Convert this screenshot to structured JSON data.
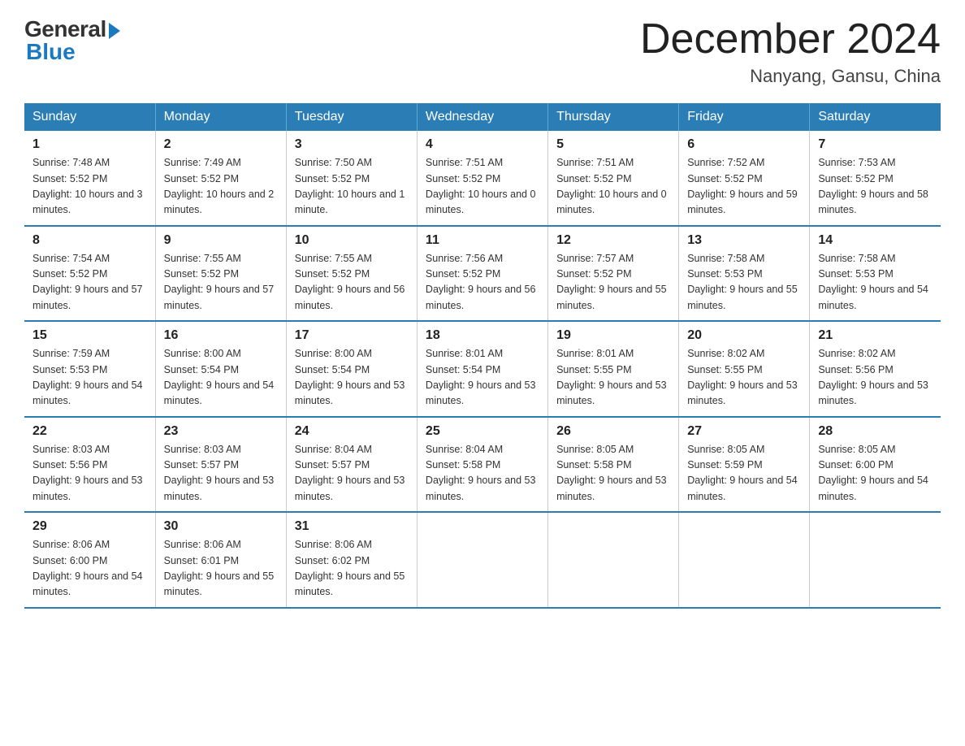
{
  "header": {
    "title": "December 2024",
    "location": "Nanyang, Gansu, China",
    "logo_general": "General",
    "logo_blue": "Blue"
  },
  "days_of_week": [
    "Sunday",
    "Monday",
    "Tuesday",
    "Wednesday",
    "Thursday",
    "Friday",
    "Saturday"
  ],
  "weeks": [
    [
      {
        "num": "1",
        "sunrise": "7:48 AM",
        "sunset": "5:52 PM",
        "daylight": "10 hours and 3 minutes."
      },
      {
        "num": "2",
        "sunrise": "7:49 AM",
        "sunset": "5:52 PM",
        "daylight": "10 hours and 2 minutes."
      },
      {
        "num": "3",
        "sunrise": "7:50 AM",
        "sunset": "5:52 PM",
        "daylight": "10 hours and 1 minute."
      },
      {
        "num": "4",
        "sunrise": "7:51 AM",
        "sunset": "5:52 PM",
        "daylight": "10 hours and 0 minutes."
      },
      {
        "num": "5",
        "sunrise": "7:51 AM",
        "sunset": "5:52 PM",
        "daylight": "10 hours and 0 minutes."
      },
      {
        "num": "6",
        "sunrise": "7:52 AM",
        "sunset": "5:52 PM",
        "daylight": "9 hours and 59 minutes."
      },
      {
        "num": "7",
        "sunrise": "7:53 AM",
        "sunset": "5:52 PM",
        "daylight": "9 hours and 58 minutes."
      }
    ],
    [
      {
        "num": "8",
        "sunrise": "7:54 AM",
        "sunset": "5:52 PM",
        "daylight": "9 hours and 57 minutes."
      },
      {
        "num": "9",
        "sunrise": "7:55 AM",
        "sunset": "5:52 PM",
        "daylight": "9 hours and 57 minutes."
      },
      {
        "num": "10",
        "sunrise": "7:55 AM",
        "sunset": "5:52 PM",
        "daylight": "9 hours and 56 minutes."
      },
      {
        "num": "11",
        "sunrise": "7:56 AM",
        "sunset": "5:52 PM",
        "daylight": "9 hours and 56 minutes."
      },
      {
        "num": "12",
        "sunrise": "7:57 AM",
        "sunset": "5:52 PM",
        "daylight": "9 hours and 55 minutes."
      },
      {
        "num": "13",
        "sunrise": "7:58 AM",
        "sunset": "5:53 PM",
        "daylight": "9 hours and 55 minutes."
      },
      {
        "num": "14",
        "sunrise": "7:58 AM",
        "sunset": "5:53 PM",
        "daylight": "9 hours and 54 minutes."
      }
    ],
    [
      {
        "num": "15",
        "sunrise": "7:59 AM",
        "sunset": "5:53 PM",
        "daylight": "9 hours and 54 minutes."
      },
      {
        "num": "16",
        "sunrise": "8:00 AM",
        "sunset": "5:54 PM",
        "daylight": "9 hours and 54 minutes."
      },
      {
        "num": "17",
        "sunrise": "8:00 AM",
        "sunset": "5:54 PM",
        "daylight": "9 hours and 53 minutes."
      },
      {
        "num": "18",
        "sunrise": "8:01 AM",
        "sunset": "5:54 PM",
        "daylight": "9 hours and 53 minutes."
      },
      {
        "num": "19",
        "sunrise": "8:01 AM",
        "sunset": "5:55 PM",
        "daylight": "9 hours and 53 minutes."
      },
      {
        "num": "20",
        "sunrise": "8:02 AM",
        "sunset": "5:55 PM",
        "daylight": "9 hours and 53 minutes."
      },
      {
        "num": "21",
        "sunrise": "8:02 AM",
        "sunset": "5:56 PM",
        "daylight": "9 hours and 53 minutes."
      }
    ],
    [
      {
        "num": "22",
        "sunrise": "8:03 AM",
        "sunset": "5:56 PM",
        "daylight": "9 hours and 53 minutes."
      },
      {
        "num": "23",
        "sunrise": "8:03 AM",
        "sunset": "5:57 PM",
        "daylight": "9 hours and 53 minutes."
      },
      {
        "num": "24",
        "sunrise": "8:04 AM",
        "sunset": "5:57 PM",
        "daylight": "9 hours and 53 minutes."
      },
      {
        "num": "25",
        "sunrise": "8:04 AM",
        "sunset": "5:58 PM",
        "daylight": "9 hours and 53 minutes."
      },
      {
        "num": "26",
        "sunrise": "8:05 AM",
        "sunset": "5:58 PM",
        "daylight": "9 hours and 53 minutes."
      },
      {
        "num": "27",
        "sunrise": "8:05 AM",
        "sunset": "5:59 PM",
        "daylight": "9 hours and 54 minutes."
      },
      {
        "num": "28",
        "sunrise": "8:05 AM",
        "sunset": "6:00 PM",
        "daylight": "9 hours and 54 minutes."
      }
    ],
    [
      {
        "num": "29",
        "sunrise": "8:06 AM",
        "sunset": "6:00 PM",
        "daylight": "9 hours and 54 minutes."
      },
      {
        "num": "30",
        "sunrise": "8:06 AM",
        "sunset": "6:01 PM",
        "daylight": "9 hours and 55 minutes."
      },
      {
        "num": "31",
        "sunrise": "8:06 AM",
        "sunset": "6:02 PM",
        "daylight": "9 hours and 55 minutes."
      },
      null,
      null,
      null,
      null
    ]
  ]
}
